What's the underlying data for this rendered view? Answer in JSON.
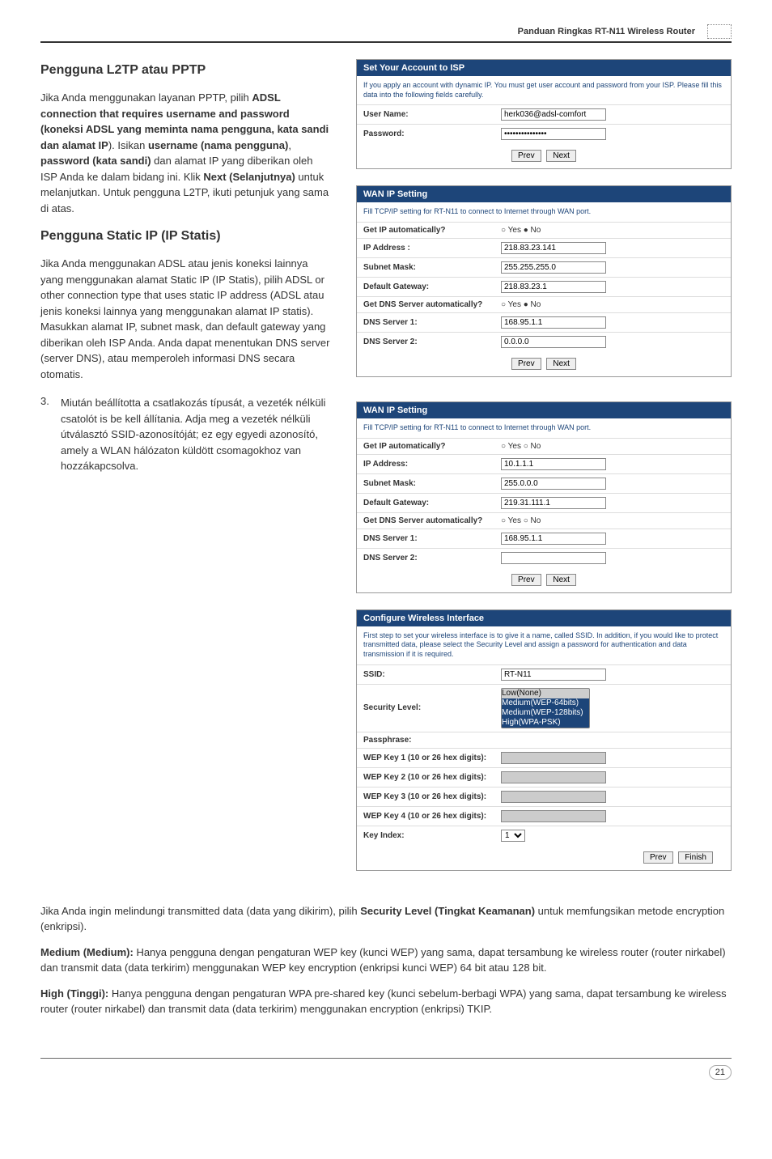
{
  "header": {
    "title": "Panduan Ringkas RT-N11 Wireless Router"
  },
  "section1": {
    "title": "Pengguna L2TP atau PPTP",
    "body": "Jika Anda menggunakan layanan PPTP, pilih ADSL connection that requires username and password (koneksi ADSL yang meminta nama pengguna, kata sandi dan alamat IP). Isikan username (nama pengguna), password (kata sandi) dan alamat IP yang diberikan oleh ISP Anda ke dalam bidang ini. Klik Next (Selanjutnya) untuk melanjutkan. Untuk pengguna L2TP, ikuti petunjuk yang sama di atas."
  },
  "section2": {
    "title": "Pengguna Static IP (IP Statis)",
    "body": "Jika Anda menggunakan ADSL atau jenis koneksi lainnya yang menggunakan alamat Static IP (IP Statis), pilih ADSL or other connection type that uses static IP address (ADSL atau jenis koneksi lainnya yang menggunakan alamat IP statis). Masukkan alamat IP, subnet mask, dan default gateway yang diberikan oleh ISP Anda. Anda dapat menentukan DNS server (server DNS), atau memperoleh informasi DNS secara otomatis."
  },
  "list_item": {
    "num": "3.",
    "text": "Miután beállította a csatlakozás típusát, a vezeték nélküli csatolót is be kell állítania. Adja meg a vezeték nélküli útválasztó SSID-azonosítóját; ez egy egyedi azonosító, amely a WLAN hálózaton küldött csomagokhoz van hozzákapcsolva."
  },
  "bottom": {
    "p1_pre": "Jika Anda ingin melindungi transmitted data (data yang dikirim), pilih ",
    "p1_bold": "Security Level (Tingkat Keamanan)",
    "p1_post": " untuk memfungsikan metode encryption (enkripsi).",
    "p2_bold": "Medium (Medium):",
    "p2_text": " Hanya pengguna dengan pengaturan WEP key (kunci WEP) yang sama, dapat tersambung ke wireless router (router nirkabel) dan transmit data (data terkirim) menggunakan WEP key encryption (enkripsi kunci WEP) 64 bit atau 128 bit.",
    "p3_bold": "High (Tinggi):",
    "p3_text": " Hanya pengguna dengan pengaturan WPA pre-shared key (kunci sebelum-berbagi WPA) yang sama, dapat tersambung ke wireless router (router nirkabel) dan transmit data (data terkirim) menggunakan encryption (enkripsi) TKIP."
  },
  "panel_account": {
    "title": "Set Your Account to ISP",
    "desc": "If you apply an account with dynamic IP. You must get user account and password from your ISP. Please fill this data into the following fields carefully.",
    "username_label": "User Name:",
    "username_value": "herk036@adsl-comfort",
    "password_label": "Password:",
    "password_value": "•••••••••••••••",
    "prev": "Prev",
    "next": "Next"
  },
  "panel_wan1": {
    "title": "WAN IP Setting",
    "desc": "Fill TCP/IP setting for RT-N11 to connect to Internet through WAN port.",
    "auto_ip_label": "Get IP automatically?",
    "auto_ip_value": "Yes  No",
    "ip_label": "IP Address :",
    "ip_value": "218.83.23.141",
    "mask_label": "Subnet Mask:",
    "mask_value": "255.255.255.0",
    "gw_label": "Default Gateway:",
    "gw_value": "218.83.23.1",
    "dns_auto_label": "Get DNS Server automatically?",
    "dns_auto_value": "Yes  No",
    "dns1_label": "DNS Server 1:",
    "dns1_value": "168.95.1.1",
    "dns2_label": "DNS Server 2:",
    "dns2_value": "0.0.0.0",
    "prev": "Prev",
    "next": "Next"
  },
  "panel_wan2": {
    "title": "WAN IP Setting",
    "desc": "Fill TCP/IP setting for RT-N11 to connect to Internet through WAN port.",
    "auto_ip_label": "Get IP automatically?",
    "auto_ip_value": "Yes  No",
    "ip_label": "IP Address:",
    "ip_value": "10.1.1.1",
    "mask_label": "Subnet Mask:",
    "mask_value": "255.0.0.0",
    "gw_label": "Default Gateway:",
    "gw_value": "219.31.111.1",
    "dns_auto_label": "Get DNS Server automatically?",
    "dns_auto_value": "Yes  No",
    "dns1_label": "DNS Server 1:",
    "dns1_value": "168.95.1.1",
    "dns2_label": "DNS Server 2:",
    "dns2_value": "",
    "prev": "Prev",
    "next": "Next"
  },
  "panel_wifi": {
    "title": "Configure Wireless Interface",
    "desc": "First step to set your wireless interface is to give it a name, called SSID. In addition, if you would like to protect transmitted data, please select the Security Level and assign a password for authentication and data transmission if it is required.",
    "ssid_label": "SSID:",
    "ssid_value": "RT-N11",
    "sec_label": "Security Level:",
    "sec_value": "Low(None)",
    "sec_options": "Low(None)\nMedium(WEP-64bits)\nMedium(WEP-128bits)\nHigh(WPA-PSK)",
    "pass_label": "Passphrase:",
    "wep1_label": "WEP Key 1 (10 or 26 hex digits):",
    "wep2_label": "WEP Key 2 (10 or 26 hex digits):",
    "wep3_label": "WEP Key 3 (10 or 26 hex digits):",
    "wep4_label": "WEP Key 4 (10 or 26 hex digits):",
    "keyidx_label": "Key Index:",
    "keyidx_value": "1",
    "prev": "Prev",
    "finish": "Finish"
  },
  "page_num": "21"
}
